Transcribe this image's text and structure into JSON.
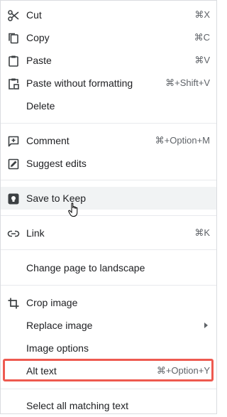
{
  "menu": {
    "cut": {
      "label": "Cut",
      "shortcut": "⌘X"
    },
    "copy": {
      "label": "Copy",
      "shortcut": "⌘C"
    },
    "paste": {
      "label": "Paste",
      "shortcut": "⌘V"
    },
    "paste_without_formatting": {
      "label": "Paste without formatting",
      "shortcut": "⌘+Shift+V"
    },
    "delete": {
      "label": "Delete"
    },
    "comment": {
      "label": "Comment",
      "shortcut": "⌘+Option+M"
    },
    "suggest_edits": {
      "label": "Suggest edits"
    },
    "save_to_keep": {
      "label": "Save to Keep"
    },
    "link": {
      "label": "Link",
      "shortcut": "⌘K"
    },
    "change_page": {
      "label": "Change page to landscape"
    },
    "crop_image": {
      "label": "Crop image"
    },
    "replace_image": {
      "label": "Replace image"
    },
    "image_options": {
      "label": "Image options"
    },
    "alt_text": {
      "label": "Alt text",
      "shortcut": "⌘+Option+Y"
    },
    "select_all_matching": {
      "label": "Select all matching text"
    }
  },
  "colors": {
    "highlight_border": "#ee5a50",
    "hover_bg": "#f1f3f4",
    "text": "#202124",
    "shortcut_text": "#5f6368"
  },
  "icons": [
    "scissors-icon",
    "copy-icon",
    "clipboard-icon",
    "paste-plain-icon",
    "comment-add-icon",
    "suggest-edits-icon",
    "keep-icon",
    "link-icon",
    "crop-icon",
    "submenu-chevron-icon",
    "hand-cursor-icon"
  ]
}
